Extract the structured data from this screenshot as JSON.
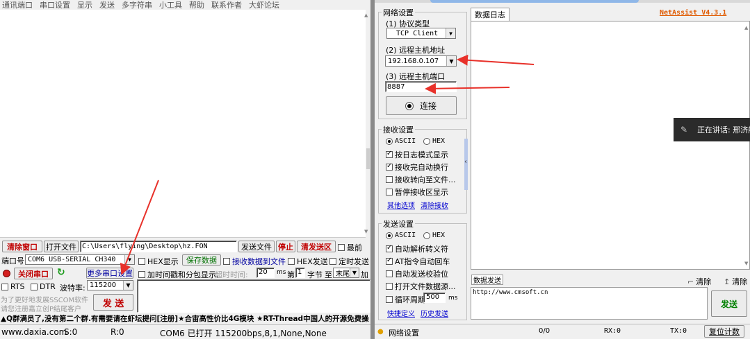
{
  "sscom": {
    "menu": [
      "通讯端口",
      "串口设置",
      "显示",
      "发送",
      "多字符串",
      "小工具",
      "帮助",
      "联系作者",
      "大虾论坛"
    ],
    "clear_window": "清除窗口",
    "open_file": "打开文件",
    "file_path": "C:\\Users\\flying\\Desktop\\hz.FON",
    "send_file": "发送文件",
    "stop": "停止",
    "clear_send_area": "清发送区",
    "front_most": "最前",
    "port_label": "端口号",
    "port_value": "COM6 USB-SERIAL CH340",
    "hex_display": "HEX显示",
    "save_data": "保存数据",
    "recv_to_file": "接收数据到文件",
    "hex_send": "HEX发送",
    "timed_send": "定时发送",
    "close_port": "关闭串口",
    "more_settings": "更多串口设置",
    "add_timestamp": "加时间戳和分包显示,",
    "timeout_label": "超时时间:",
    "timeout_value": "20",
    "ms": "ms",
    "nth_label": "第",
    "nth_value": "1",
    "byte_label": "字节",
    "to_label": "至",
    "end_value": "末尾",
    "add_label": "加",
    "rts": "RTS",
    "dtr": "DTR",
    "baud_label": "波特率:",
    "baud_value": "115200",
    "promo_line1": "为了更好地发展SSCOM软件",
    "promo_line2": "请您注册嘉立创P结尾客户",
    "send": "发 送",
    "ticker": "▲Q群满员了,没有第二个群.有需要请在虾坛提问[注册]★合宙高性价比4G模块 ★RT-Thread中国人的开源免费操",
    "status": {
      "website": "www.daxia.com",
      "s": "S:0",
      "r": "R:0",
      "port_info": "COM6 已打开  115200bps,8,1,None,None"
    }
  },
  "netassist": {
    "net_settings": "网络设置",
    "proto_label": "(1) 协议类型",
    "proto_value": "TCP Client",
    "host_label": "(2) 远程主机地址",
    "host_value": "192.168.0.107",
    "port_label": "(3) 远程主机端口",
    "port_value": "8887",
    "connect": "连接",
    "recv_settings": "接收设置",
    "ascii": "ASCII",
    "hex": "HEX",
    "log_mode": "按日志模式显示",
    "auto_newline": "接收完自动换行",
    "recv_to_file": "接收转向至文件...",
    "pause_recv": "暂停接收区显示",
    "other_options": "其他选项",
    "clear_recv": "清除接收",
    "send_settings": "发送设置",
    "auto_escape": "自动解析转义符",
    "at_auto_crlf": "AT指令自动回车",
    "auto_checksum": "自动发送校验位",
    "open_file_src": "打开文件数据源...",
    "loop_period": "循环周期",
    "loop_value": "500",
    "loop_unit": "ms",
    "shortcut_def": "快捷定义",
    "history_send": "历史发送",
    "data_log_tab": "数据日志",
    "brand": "NetAssist V4.3.1",
    "data_send_label": "数据发送",
    "clear_btn": "清除",
    "clear_btn2": "清除",
    "send_text": "http://www.cmsoft.cn",
    "send_btn": "发送",
    "status": {
      "net_settings": "网络设置",
      "count": "0/0",
      "rx": "RX:0",
      "tx": "TX:0",
      "reset": "复位计数"
    }
  },
  "overlay": {
    "speaking": "正在讲话: 邢济航"
  },
  "colors": {
    "arrow": "#e8312a",
    "brand": "#e05a00",
    "red_label": "#c00000",
    "link": "#0000d0"
  }
}
